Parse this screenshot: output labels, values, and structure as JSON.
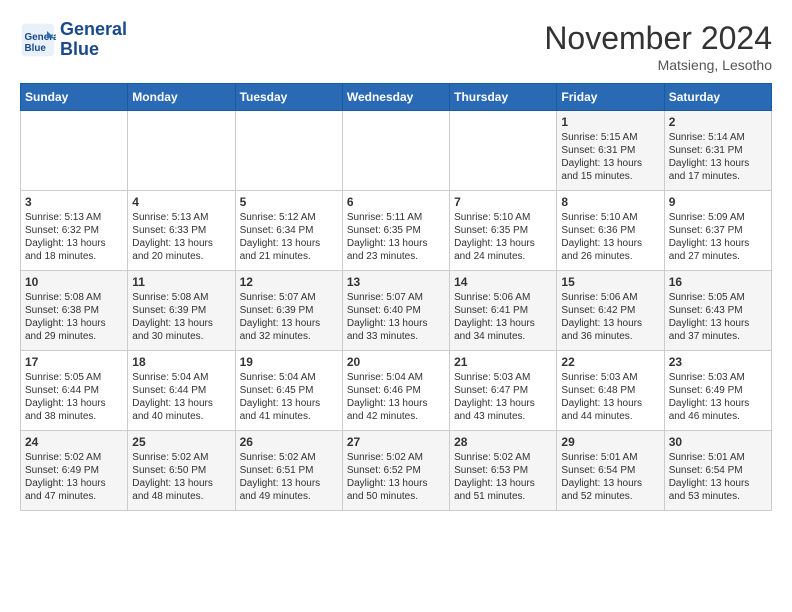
{
  "header": {
    "logo_line1": "General",
    "logo_line2": "Blue",
    "month": "November 2024",
    "location": "Matsieng, Lesotho"
  },
  "weekdays": [
    "Sunday",
    "Monday",
    "Tuesday",
    "Wednesday",
    "Thursday",
    "Friday",
    "Saturday"
  ],
  "weeks": [
    [
      {
        "day": "",
        "info": ""
      },
      {
        "day": "",
        "info": ""
      },
      {
        "day": "",
        "info": ""
      },
      {
        "day": "",
        "info": ""
      },
      {
        "day": "",
        "info": ""
      },
      {
        "day": "1",
        "info": "Sunrise: 5:15 AM\nSunset: 6:31 PM\nDaylight: 13 hours and 15 minutes."
      },
      {
        "day": "2",
        "info": "Sunrise: 5:14 AM\nSunset: 6:31 PM\nDaylight: 13 hours and 17 minutes."
      }
    ],
    [
      {
        "day": "3",
        "info": "Sunrise: 5:13 AM\nSunset: 6:32 PM\nDaylight: 13 hours and 18 minutes."
      },
      {
        "day": "4",
        "info": "Sunrise: 5:13 AM\nSunset: 6:33 PM\nDaylight: 13 hours and 20 minutes."
      },
      {
        "day": "5",
        "info": "Sunrise: 5:12 AM\nSunset: 6:34 PM\nDaylight: 13 hours and 21 minutes."
      },
      {
        "day": "6",
        "info": "Sunrise: 5:11 AM\nSunset: 6:35 PM\nDaylight: 13 hours and 23 minutes."
      },
      {
        "day": "7",
        "info": "Sunrise: 5:10 AM\nSunset: 6:35 PM\nDaylight: 13 hours and 24 minutes."
      },
      {
        "day": "8",
        "info": "Sunrise: 5:10 AM\nSunset: 6:36 PM\nDaylight: 13 hours and 26 minutes."
      },
      {
        "day": "9",
        "info": "Sunrise: 5:09 AM\nSunset: 6:37 PM\nDaylight: 13 hours and 27 minutes."
      }
    ],
    [
      {
        "day": "10",
        "info": "Sunrise: 5:08 AM\nSunset: 6:38 PM\nDaylight: 13 hours and 29 minutes."
      },
      {
        "day": "11",
        "info": "Sunrise: 5:08 AM\nSunset: 6:39 PM\nDaylight: 13 hours and 30 minutes."
      },
      {
        "day": "12",
        "info": "Sunrise: 5:07 AM\nSunset: 6:39 PM\nDaylight: 13 hours and 32 minutes."
      },
      {
        "day": "13",
        "info": "Sunrise: 5:07 AM\nSunset: 6:40 PM\nDaylight: 13 hours and 33 minutes."
      },
      {
        "day": "14",
        "info": "Sunrise: 5:06 AM\nSunset: 6:41 PM\nDaylight: 13 hours and 34 minutes."
      },
      {
        "day": "15",
        "info": "Sunrise: 5:06 AM\nSunset: 6:42 PM\nDaylight: 13 hours and 36 minutes."
      },
      {
        "day": "16",
        "info": "Sunrise: 5:05 AM\nSunset: 6:43 PM\nDaylight: 13 hours and 37 minutes."
      }
    ],
    [
      {
        "day": "17",
        "info": "Sunrise: 5:05 AM\nSunset: 6:44 PM\nDaylight: 13 hours and 38 minutes."
      },
      {
        "day": "18",
        "info": "Sunrise: 5:04 AM\nSunset: 6:44 PM\nDaylight: 13 hours and 40 minutes."
      },
      {
        "day": "19",
        "info": "Sunrise: 5:04 AM\nSunset: 6:45 PM\nDaylight: 13 hours and 41 minutes."
      },
      {
        "day": "20",
        "info": "Sunrise: 5:04 AM\nSunset: 6:46 PM\nDaylight: 13 hours and 42 minutes."
      },
      {
        "day": "21",
        "info": "Sunrise: 5:03 AM\nSunset: 6:47 PM\nDaylight: 13 hours and 43 minutes."
      },
      {
        "day": "22",
        "info": "Sunrise: 5:03 AM\nSunset: 6:48 PM\nDaylight: 13 hours and 44 minutes."
      },
      {
        "day": "23",
        "info": "Sunrise: 5:03 AM\nSunset: 6:49 PM\nDaylight: 13 hours and 46 minutes."
      }
    ],
    [
      {
        "day": "24",
        "info": "Sunrise: 5:02 AM\nSunset: 6:49 PM\nDaylight: 13 hours and 47 minutes."
      },
      {
        "day": "25",
        "info": "Sunrise: 5:02 AM\nSunset: 6:50 PM\nDaylight: 13 hours and 48 minutes."
      },
      {
        "day": "26",
        "info": "Sunrise: 5:02 AM\nSunset: 6:51 PM\nDaylight: 13 hours and 49 minutes."
      },
      {
        "day": "27",
        "info": "Sunrise: 5:02 AM\nSunset: 6:52 PM\nDaylight: 13 hours and 50 minutes."
      },
      {
        "day": "28",
        "info": "Sunrise: 5:02 AM\nSunset: 6:53 PM\nDaylight: 13 hours and 51 minutes."
      },
      {
        "day": "29",
        "info": "Sunrise: 5:01 AM\nSunset: 6:54 PM\nDaylight: 13 hours and 52 minutes."
      },
      {
        "day": "30",
        "info": "Sunrise: 5:01 AM\nSunset: 6:54 PM\nDaylight: 13 hours and 53 minutes."
      }
    ]
  ]
}
